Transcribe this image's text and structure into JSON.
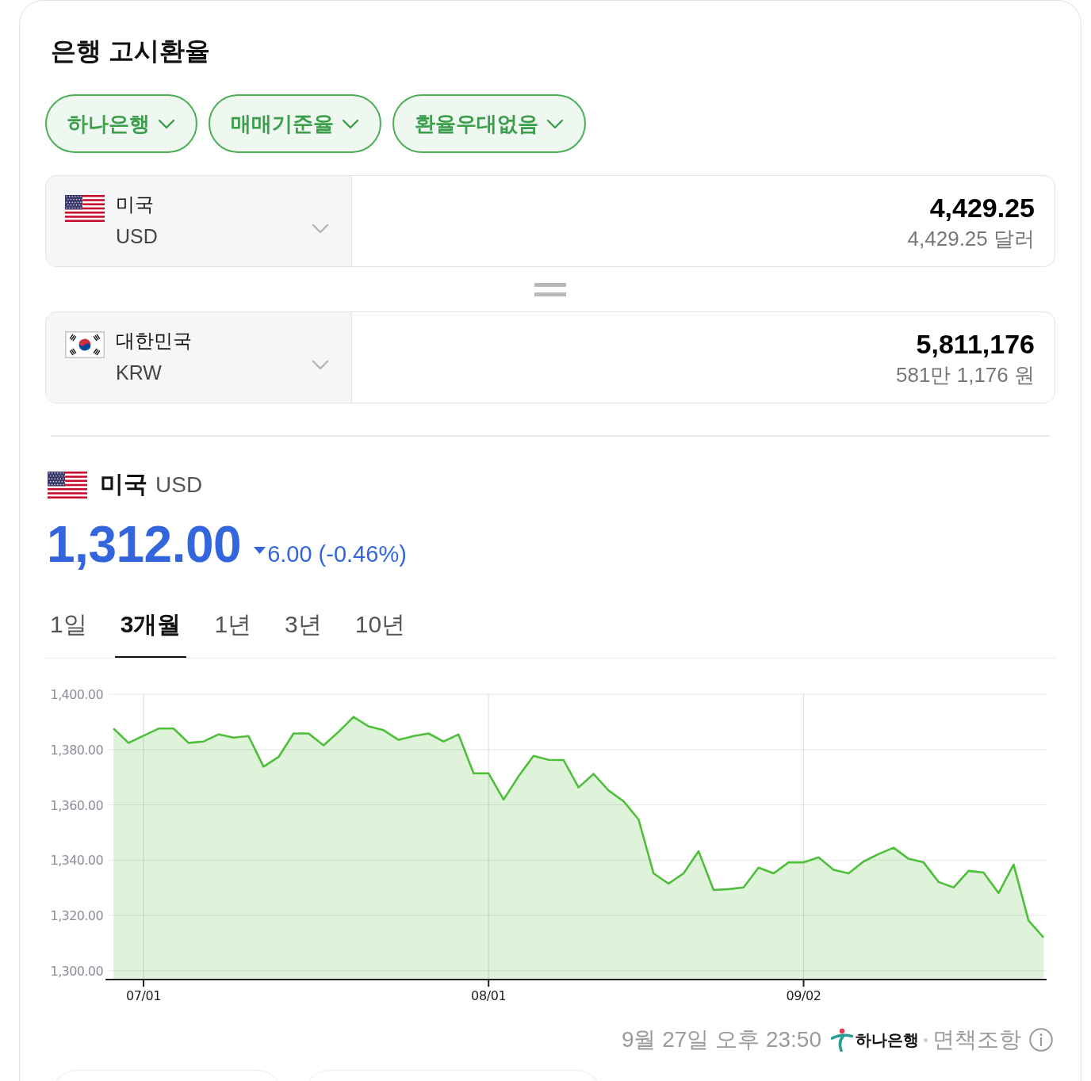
{
  "title": "은행 고시환율",
  "filters": [
    {
      "label": "하나은행"
    },
    {
      "label": "매매기준율"
    },
    {
      "label": "환율우대없음"
    }
  ],
  "converter": {
    "rows": [
      {
        "kind": "us",
        "country": "미국",
        "code": "USD",
        "amount": "4,429.25",
        "amount_in_words": "4,429.25 달러"
      },
      {
        "kind": "kr",
        "country": "대한민국",
        "code": "KRW",
        "amount": "5,811,176",
        "amount_in_words": "581만 1,176 원"
      }
    ]
  },
  "quote": {
    "kind": "us",
    "country": "미국",
    "code": "USD",
    "price": "1,312.00",
    "falling": true,
    "change": "6.00 (-0.46%)",
    "periods": [
      {
        "label": "1일",
        "selected": false
      },
      {
        "label": "3개월",
        "selected": true
      },
      {
        "label": "1년",
        "selected": false
      },
      {
        "label": "3년",
        "selected": false
      },
      {
        "label": "10년",
        "selected": false
      }
    ],
    "chart_data": {
      "type": "area",
      "grid": true,
      "categories": [
        null,
        null,
        "07/01",
        null,
        null,
        null,
        null,
        null,
        null,
        null,
        null,
        null,
        null,
        null,
        null,
        null,
        null,
        null,
        null,
        null,
        null,
        null,
        null,
        null,
        null,
        "08/01",
        null,
        null,
        null,
        null,
        null,
        null,
        null,
        null,
        null,
        null,
        null,
        null,
        null,
        null,
        null,
        null,
        null,
        null,
        null,
        null,
        "09/02",
        null,
        null,
        null,
        null,
        null,
        null,
        null,
        null,
        null,
        null,
        null,
        null,
        null,
        null,
        null,
        null
      ],
      "series": [
        {
          "color": "#4dbf3a",
          "values": [
            1387.6,
            1382.4,
            1385.0,
            1387.6,
            1387.6,
            1382.4,
            1382.9,
            1385.5,
            1384.3,
            1384.9,
            1373.8,
            1377.3,
            1385.8,
            1385.8,
            1381.5,
            1386.4,
            1391.8,
            1388.4,
            1387.0,
            1383.5,
            1384.9,
            1385.8,
            1382.9,
            1385.5,
            1371.4,
            1371.4,
            1361.9,
            1370.3,
            1377.7,
            1376.3,
            1376.2,
            1366.3,
            1371.2,
            1365.2,
            1361.3,
            1354.7,
            1335.2,
            1331.5,
            1335.2,
            1343.2,
            1329.2,
            1329.5,
            1330.1,
            1337.3,
            1335.2,
            1339.2,
            1339.2,
            1341.0,
            1336.5,
            1335.2,
            1339.5,
            1342.2,
            1344.5,
            1340.5,
            1339.2,
            1332.1,
            1330.1,
            1336.1,
            1335.5,
            1328.1,
            1338.4,
            1318.1,
            1312.0
          ]
        }
      ],
      "ylim": [
        1296.8,
        1400
      ],
      "yticks": [
        {
          "value": 1300,
          "label": "1,300.00"
        },
        {
          "value": 1320,
          "label": "1,320.00"
        },
        {
          "value": 1340,
          "label": "1,340.00"
        },
        {
          "value": 1360,
          "label": "1,360.00"
        },
        {
          "value": 1380,
          "label": "1,380.00"
        },
        {
          "value": 1400,
          "label": "1,400.00"
        }
      ]
    }
  },
  "footer": {
    "timestamp": "9월 27일 오후 23:50",
    "source": "하나은행",
    "disclaimer": "면책조항"
  }
}
